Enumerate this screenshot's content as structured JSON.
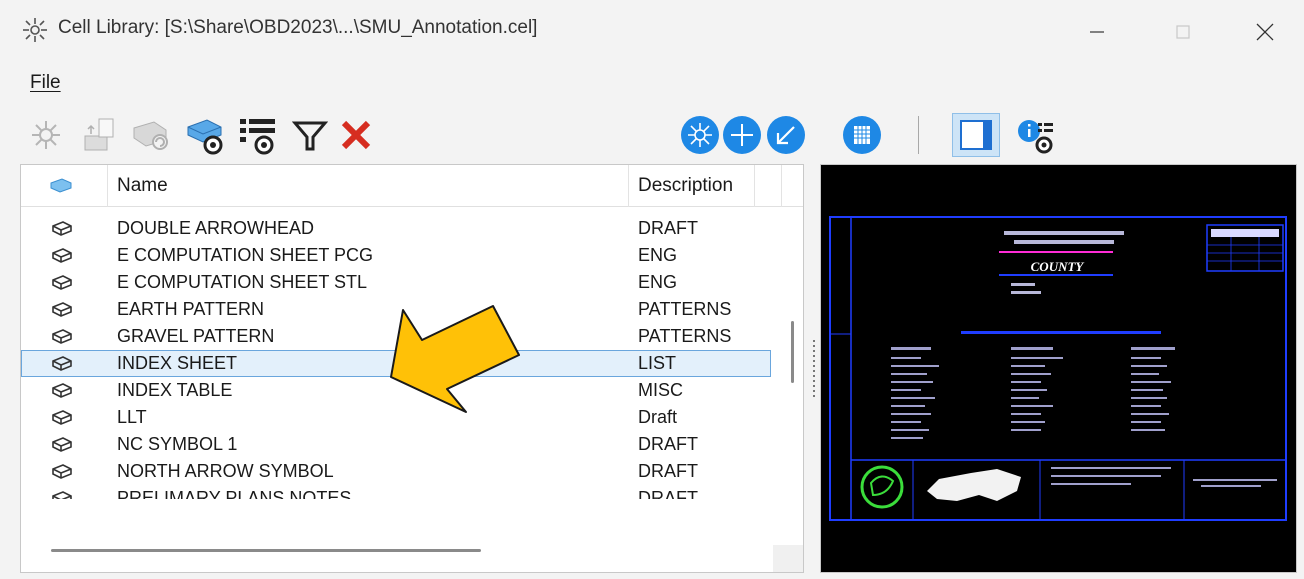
{
  "window": {
    "title": "Cell Library: [S:\\Share\\OBD2023\\...\\SMU_Annotation.cel]",
    "minimize_icon": "minimize-icon",
    "maximize_icon": "maximize-icon",
    "close_icon": "close-icon"
  },
  "menu": {
    "file": "File"
  },
  "toolbar": {
    "icons": [
      "place-cell-icon",
      "create-cell-icon",
      "refresh-cell-icon",
      "show-cells-icon",
      "show-columns-icon",
      "filter-icon",
      "delete-icon",
      "active-cell-icon",
      "active-point-icon",
      "terminator-icon",
      "pattern-icon",
      "preview-icon",
      "show-info-icon"
    ],
    "colors": {
      "blue": "#1e88e5",
      "red": "#d62d20"
    }
  },
  "list": {
    "header": {
      "name": "Name",
      "description": "Description"
    },
    "rows": [
      {
        "name": "DOUBLE ARROWHEAD",
        "description": "DRAFT",
        "selected": false
      },
      {
        "name": "E COMPUTATION SHEET PCG",
        "description": "ENG",
        "selected": false
      },
      {
        "name": "E COMPUTATION SHEET STL",
        "description": "ENG",
        "selected": false
      },
      {
        "name": "EARTH PATTERN",
        "description": "PATTERNS",
        "selected": false
      },
      {
        "name": "GRAVEL PATTERN",
        "description": "PATTERNS",
        "selected": false
      },
      {
        "name": "INDEX SHEET",
        "description": "LIST",
        "selected": true
      },
      {
        "name": "INDEX TABLE",
        "description": "MISC",
        "selected": false
      },
      {
        "name": "LLT",
        "description": "Draft",
        "selected": false
      },
      {
        "name": "NC SYMBOL 1",
        "description": "DRAFT",
        "selected": false
      },
      {
        "name": "NORTH ARROW SYMBOL",
        "description": "DRAFT",
        "selected": false
      },
      {
        "name": "PRELIMARY PLANS NOTES",
        "description": "DRAFT",
        "selected": false
      }
    ]
  },
  "preview": {
    "county_label": "COUNTY",
    "colors": {
      "background": "#000000",
      "border": "#1f3dff",
      "accent": "#ff2bd6",
      "seal": "#3bdd3b"
    }
  },
  "annotation": {
    "arrow_color": "#ffc107"
  }
}
